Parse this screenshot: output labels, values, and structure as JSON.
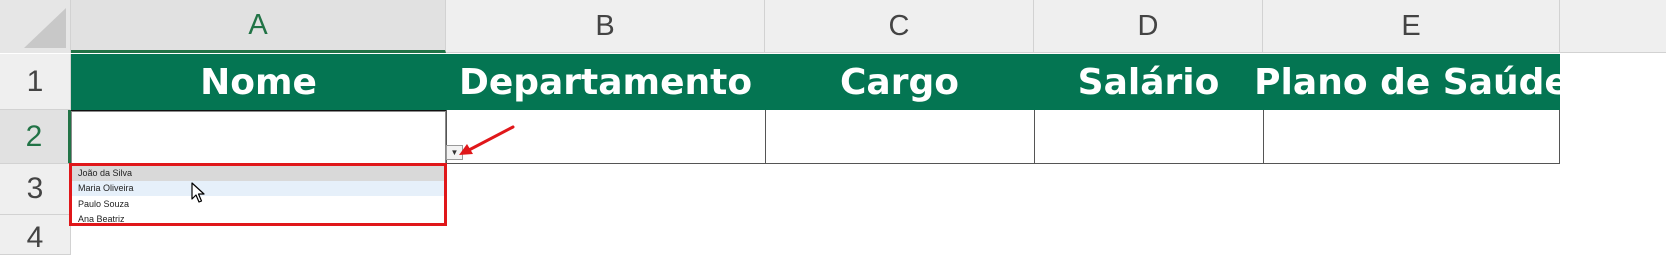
{
  "columns": [
    "A",
    "B",
    "C",
    "D",
    "E"
  ],
  "rows": [
    "1",
    "2",
    "3",
    "4"
  ],
  "headers": {
    "nome": "Nome",
    "departamento": "Departamento",
    "cargo": "Cargo",
    "salario": "Salário",
    "plano": "Plano de Saúde"
  },
  "dropdown": {
    "items": [
      "João da Silva",
      "Maria Oliveira",
      "Paulo Souza",
      "Ana Beatriz"
    ],
    "selected_index": 0,
    "hover_index": 1
  },
  "colors": {
    "header_green": "#047552",
    "active_header_text": "#217346",
    "highlight_red": "#e0171a"
  },
  "icons": [
    "dropdown-arrow-icon",
    "mouse-cursor-icon",
    "red-pointer-arrow-icon"
  ]
}
